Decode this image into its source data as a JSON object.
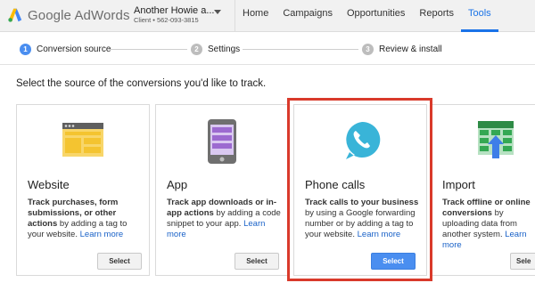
{
  "header": {
    "logo_google": "Google",
    "logo_product": "AdWords",
    "account_name": "Another Howie a...",
    "account_client": "Client • 562-093-3815",
    "nav": [
      "Home",
      "Campaigns",
      "Opportunities",
      "Reports",
      "Tools"
    ],
    "active_nav": "Tools",
    "accent": "#1a73e8"
  },
  "steps": [
    {
      "num": "1",
      "label": "Conversion source",
      "active": true
    },
    {
      "num": "2",
      "label": "Settings",
      "active": false
    },
    {
      "num": "3",
      "label": "Review & install",
      "active": false
    }
  ],
  "prompt": "Select the source of the conversions you'd like to track.",
  "cards": [
    {
      "title": "Website",
      "icon": "website-icon",
      "desc_bold_1": "Track purchases, form submissions, or other actions",
      "desc_rest_1": " by adding a tag to your website. ",
      "link": "Learn more",
      "button": "Select",
      "selected": false
    },
    {
      "title": "App",
      "icon": "phone-app-icon",
      "desc_bold_1": "Track app downloads or in-app actions",
      "desc_rest_1": " by adding a code snippet to your app. ",
      "link": "Learn more",
      "button": "Select",
      "selected": false
    },
    {
      "title": "Phone calls",
      "icon": "phone-call-icon",
      "desc_bold_1": "Track calls to your business",
      "desc_rest_1": " by using a Google forwarding number or by adding a tag to your website. ",
      "link": "Learn more",
      "button": "Select",
      "selected": true
    },
    {
      "title": "Import",
      "icon": "import-icon",
      "desc_bold_1": "Track offline or online conversions",
      "desc_rest_1": " by uploading data from another system. ",
      "link": "Learn more",
      "button": "Sele",
      "selected": false
    }
  ],
  "colors": {
    "highlight": "#d93a2b",
    "primary_button": "#4a8ef0",
    "website_yellow": "#f4c430",
    "app_purple": "#9c6ad0",
    "call_teal": "#39b4d8",
    "import_green": "#34a853"
  }
}
